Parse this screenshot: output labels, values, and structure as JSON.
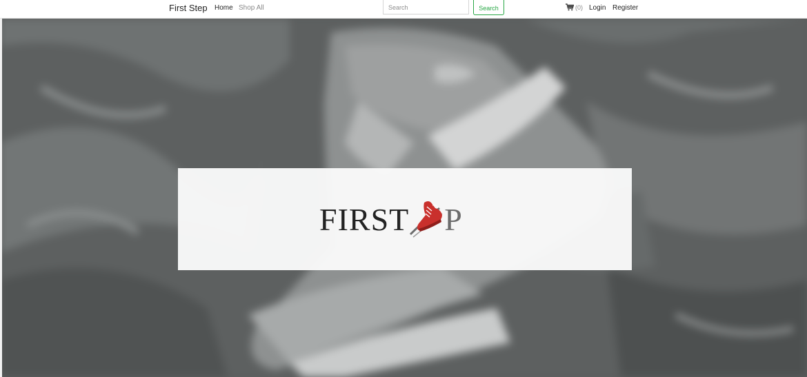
{
  "navbar": {
    "brand": "First Step",
    "links": {
      "home": "Home",
      "shop_all": "Shop All",
      "login": "Login",
      "register": "Register"
    },
    "search": {
      "placeholder": "Search",
      "button_label": "Search"
    },
    "cart": {
      "icon": "cart-icon",
      "count_text": "(0)"
    }
  },
  "hero": {
    "logo": {
      "text_dark": "FIRS",
      "text_mid": "T",
      "text_end": "P",
      "icon": "running-shoe-icon",
      "accent_color": "#c9302c"
    }
  },
  "colors": {
    "success": "#28a745",
    "text": "#222222",
    "muted": "#8a8a8a"
  }
}
